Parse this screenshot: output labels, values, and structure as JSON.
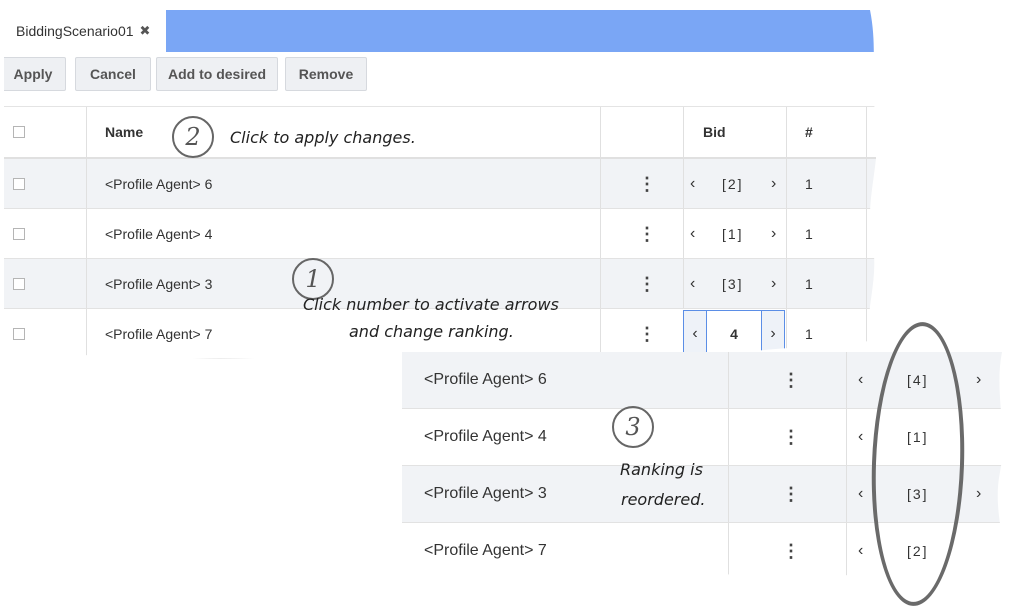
{
  "tab": {
    "title": "BiddingScenario01",
    "close_glyph": "✖"
  },
  "toolbar": {
    "apply": "Apply",
    "cancel": "Cancel",
    "add_desired": "Add to desired",
    "remove": "Remove"
  },
  "columns": {
    "name": "Name",
    "bid": "Bid",
    "number": "#"
  },
  "icons": {
    "menu": "⋮",
    "prev": "‹",
    "next": "›"
  },
  "rows": [
    {
      "name": "<Profile Agent> 6",
      "rank": "[2]",
      "count": "1"
    },
    {
      "name": "<Profile Agent> 4",
      "rank": "[1]",
      "count": "1"
    },
    {
      "name": "<Profile Agent> 3",
      "rank": "[3]",
      "count": "1"
    },
    {
      "name": "<Profile Agent> 7",
      "rank": "4",
      "count": "1"
    }
  ],
  "reordered_rows": [
    {
      "name": "<Profile Agent> 6",
      "rank": "[4]"
    },
    {
      "name": "<Profile Agent> 4",
      "rank": "[1]"
    },
    {
      "name": "<Profile Agent> 3",
      "rank": "[3]"
    },
    {
      "name": "<Profile Agent> 7",
      "rank": "[2]"
    }
  ],
  "annotations": {
    "step1": {
      "number": "1",
      "text_line1": "Click number to activate arrows",
      "text_line2": "and change ranking."
    },
    "step2": {
      "number": "2",
      "text": "Click to apply changes."
    },
    "step3": {
      "number": "3",
      "text_line1": "Ranking is",
      "text_line2": "reordered."
    }
  },
  "colors": {
    "tab_bar": "#7aa6f5",
    "active_border": "#5b8ee6",
    "row_alt": "#f1f3f6"
  }
}
